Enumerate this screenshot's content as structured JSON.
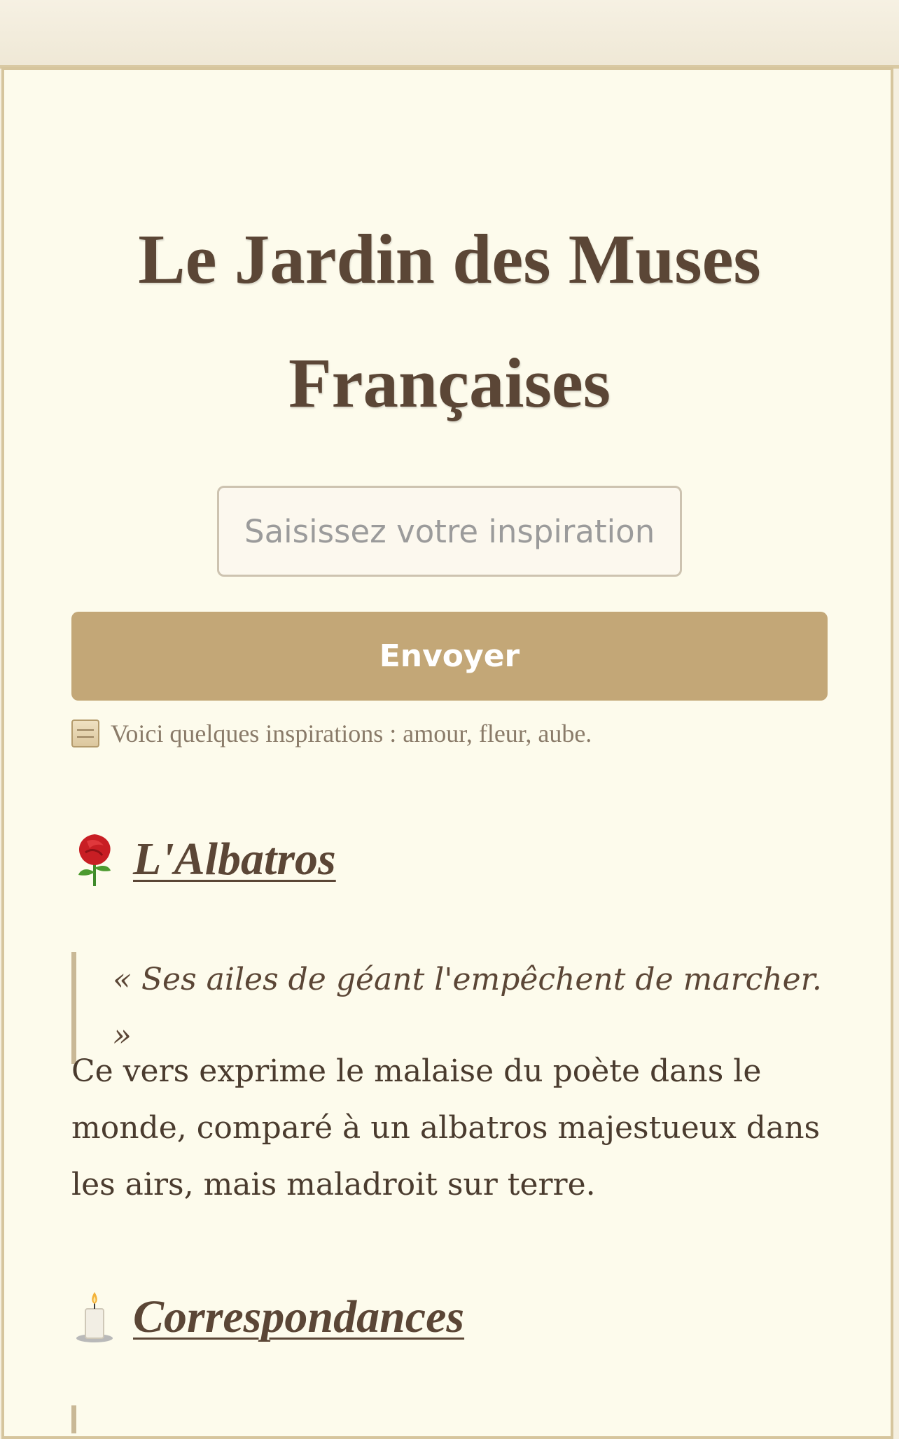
{
  "page": {
    "title": "Le Jardin des Muses Françaises"
  },
  "search": {
    "placeholder": "Saisissez votre inspiration ici"
  },
  "actions": {
    "send_label": "Envoyer"
  },
  "hint": {
    "text": "Voici quelques inspirations : amour, fleur, aube.",
    "icon": "scroll-icon"
  },
  "poems": [
    {
      "icon": "rose-icon",
      "title": "L'Albatros",
      "quote": "« Ses ailes de géant l'empêchent de marcher. »",
      "description": "Ce vers exprime le malaise du poète dans le monde, comparé à un albatros majestueux dans les airs, mais maladroit sur terre."
    },
    {
      "icon": "candle-icon",
      "title": "Correspondances"
    }
  ],
  "colors": {
    "background": "#fdfbec",
    "border": "#d6c59d",
    "text": "#5b4636",
    "button": "#c3a777",
    "quote_bar": "#c9b896"
  }
}
